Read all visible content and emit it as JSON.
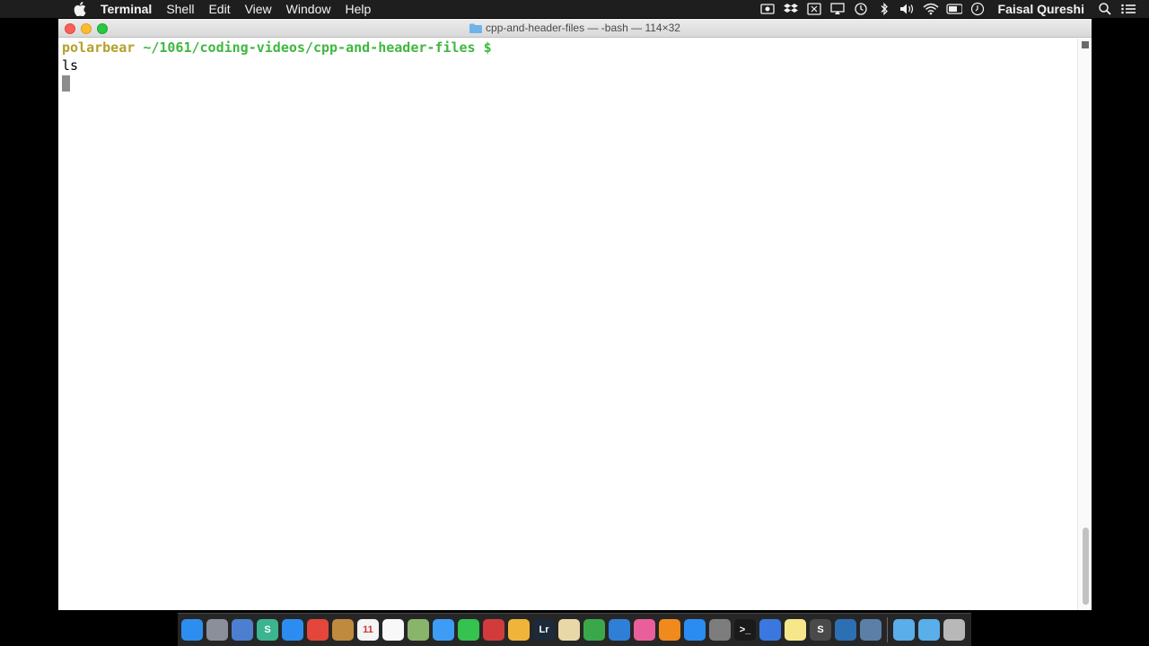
{
  "menubar": {
    "app_name": "Terminal",
    "menus": [
      "Shell",
      "Edit",
      "View",
      "Window",
      "Help"
    ],
    "user": "Faisal Qureshi",
    "status_icons": [
      "screen-record-icon",
      "dropbox-icon",
      "screenshot-icon",
      "airplay-icon",
      "time-machine-icon",
      "bluetooth-icon",
      "volume-icon",
      "wifi-icon",
      "battery-icon",
      "clock-icon",
      "spotlight-icon",
      "notification-center-icon"
    ]
  },
  "window": {
    "title": "cpp-and-header-files — -bash — 114×32"
  },
  "terminal": {
    "prompt_host": "polarbear",
    "prompt_path": "~/1061/coding-videos/cpp-and-header-files $",
    "command": "ls"
  },
  "dock": {
    "apps": [
      {
        "name": "finder",
        "color": "#2e8ef0",
        "label": ""
      },
      {
        "name": "launchpad",
        "color": "#8a8f99",
        "label": ""
      },
      {
        "name": "preview",
        "color": "#4c7fcf",
        "label": ""
      },
      {
        "name": "slack",
        "color": "#3bb58f",
        "label": "S"
      },
      {
        "name": "safari",
        "color": "#2d8cf0",
        "label": ""
      },
      {
        "name": "chrome",
        "color": "#e4463b",
        "label": ""
      },
      {
        "name": "notebook",
        "color": "#c08a3e",
        "label": ""
      },
      {
        "name": "calendar",
        "color": "#f4f4f4",
        "label": "11"
      },
      {
        "name": "notes-list",
        "color": "#f8f8f8",
        "label": ""
      },
      {
        "name": "photo-preview",
        "color": "#89b56b",
        "label": ""
      },
      {
        "name": "messages",
        "color": "#3d9df5",
        "label": ""
      },
      {
        "name": "facetime",
        "color": "#35c24e",
        "label": ""
      },
      {
        "name": "photo-booth",
        "color": "#d23b3b",
        "label": ""
      },
      {
        "name": "photos",
        "color": "#f0b43a",
        "label": ""
      },
      {
        "name": "lightroom",
        "color": "#1c2a3a",
        "label": "Lr"
      },
      {
        "name": "textedit",
        "color": "#e8d8a8",
        "label": ""
      },
      {
        "name": "numbers",
        "color": "#3aa84a",
        "label": ""
      },
      {
        "name": "keynote",
        "color": "#2f7fd8",
        "label": ""
      },
      {
        "name": "itunes",
        "color": "#e95f9c",
        "label": ""
      },
      {
        "name": "ibooks",
        "color": "#f08a1c",
        "label": ""
      },
      {
        "name": "app-store",
        "color": "#2a8cf0",
        "label": ""
      },
      {
        "name": "system-preferences",
        "color": "#7d7d7d",
        "label": ""
      },
      {
        "name": "terminal",
        "color": "#1a1a1a",
        "label": ">_"
      },
      {
        "name": "xcode",
        "color": "#3a78e0",
        "label": ""
      },
      {
        "name": "stickies",
        "color": "#f6e88a",
        "label": ""
      },
      {
        "name": "sublime-text",
        "color": "#4a4a4a",
        "label": "S"
      },
      {
        "name": "edge-browser",
        "color": "#2c6fb3",
        "label": ""
      },
      {
        "name": "screen-recorder",
        "color": "#5c7fa8",
        "label": ""
      }
    ],
    "folders": [
      {
        "name": "documents-folder",
        "color": "#5aaeea"
      },
      {
        "name": "downloads-folder",
        "color": "#5aaeea"
      },
      {
        "name": "trash",
        "color": "#b8b8b8"
      }
    ]
  }
}
